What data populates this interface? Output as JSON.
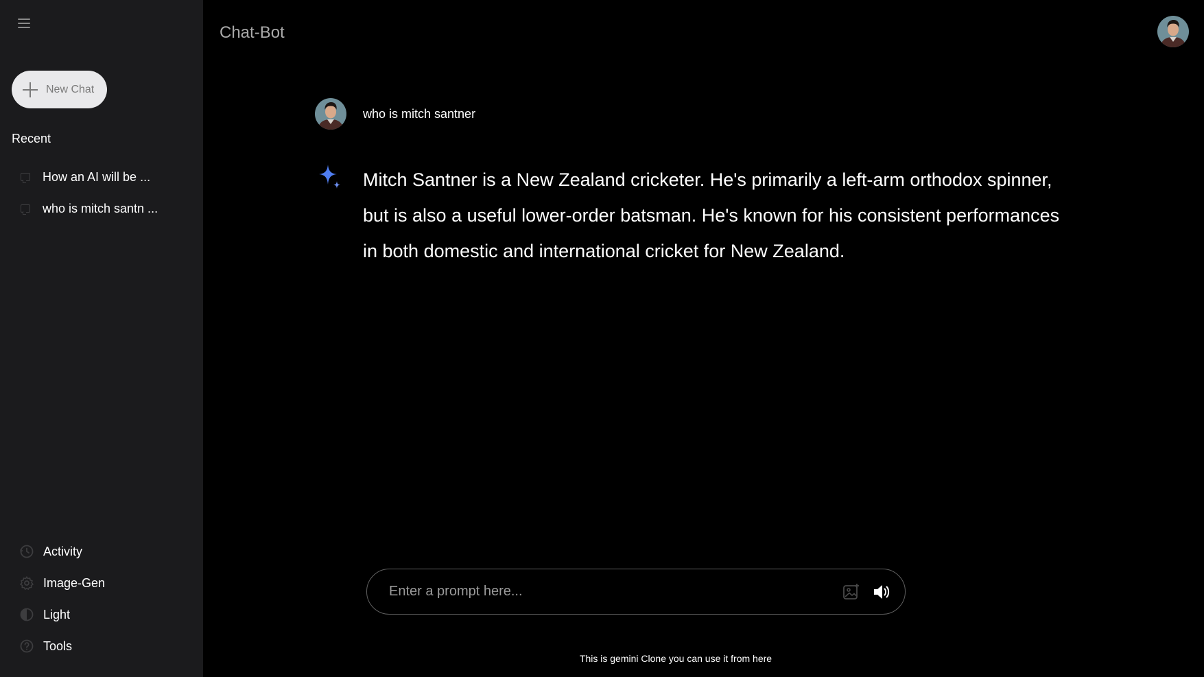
{
  "app": {
    "title": "Chat-Bot"
  },
  "sidebar": {
    "new_chat_label": "New Chat",
    "recent_title": "Recent",
    "recent": [
      {
        "label": "How an AI will be ..."
      },
      {
        "label": "who is mitch santn ..."
      }
    ],
    "bottom": [
      {
        "label": "Activity",
        "icon": "history-icon"
      },
      {
        "label": "Image-Gen",
        "icon": "gear-icon"
      },
      {
        "label": "Light",
        "icon": "half-moon-icon"
      },
      {
        "label": "Tools",
        "icon": "help-circle-icon"
      }
    ]
  },
  "chat": {
    "user_prompt": "who is mitch santner",
    "response": "Mitch Santner is a New Zealand cricketer. He's primarily a left-arm orthodox spinner, but is also a useful lower-order batsman. He's known for his consistent performances in both domestic and international cricket for New Zealand."
  },
  "input": {
    "placeholder": "Enter a prompt here...",
    "value": ""
  },
  "footer": {
    "note": "This is gemini Clone you can use it from here"
  },
  "colors": {
    "sidebar_bg": "#1b1b1d",
    "main_bg": "#000000",
    "new_chat_bg": "#e9e9eb",
    "sparkle_blue": "#4f7df0"
  }
}
